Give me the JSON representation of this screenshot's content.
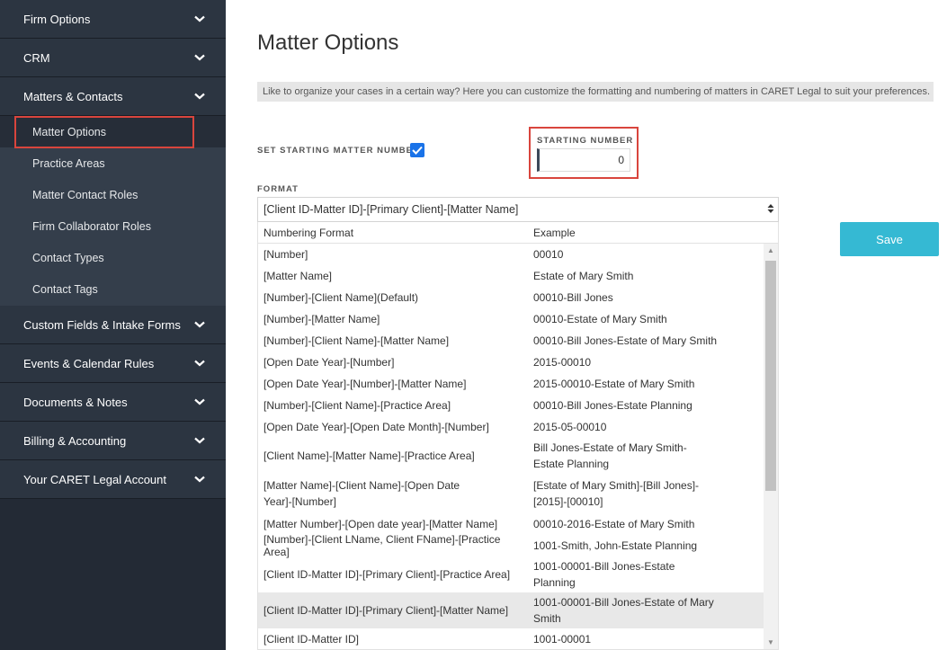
{
  "sidebar": {
    "sections_top": [
      {
        "label": "Firm Options"
      },
      {
        "label": "CRM"
      },
      {
        "label": "Matters & Contacts"
      }
    ],
    "sub_items": [
      {
        "label": "Matter Options"
      },
      {
        "label": "Practice Areas"
      },
      {
        "label": "Matter Contact Roles"
      },
      {
        "label": "Firm Collaborator Roles"
      },
      {
        "label": "Contact Types"
      },
      {
        "label": "Contact Tags"
      }
    ],
    "sections_bottom": [
      {
        "label": "Custom Fields & Intake Forms"
      },
      {
        "label": "Events & Calendar Rules"
      },
      {
        "label": "Documents & Notes"
      },
      {
        "label": "Billing & Accounting"
      },
      {
        "label": "Your CARET Legal Account"
      }
    ]
  },
  "main": {
    "title": "Matter Options",
    "info": "Like to organize your cases in a certain way? Here you can customize the formatting and numbering of matters in CARET Legal to suit your preferences.",
    "set_start_label": "SET STARTING MATTER NUMBER:",
    "set_start_checked": true,
    "starting_label": "STARTING NUMBER",
    "starting_value": "0",
    "format_label": "FORMAT",
    "format_selected": "[Client ID-Matter ID]-[Primary Client]-[Matter Name]",
    "save_label": "Save",
    "table": {
      "headers": [
        "Numbering Format",
        "Example"
      ],
      "rows": [
        {
          "format": "[Number]",
          "example": "00010"
        },
        {
          "format": "[Matter Name]",
          "example": "Estate of Mary Smith"
        },
        {
          "format": "[Number]-[Client Name](Default)",
          "example": "00010-Bill Jones"
        },
        {
          "format": "[Number]-[Matter Name]",
          "example": "00010-Estate of Mary Smith"
        },
        {
          "format": "[Number]-[Client Name]-[Matter Name]",
          "example": "00010-Bill Jones-Estate of Mary Smith"
        },
        {
          "format": "[Open Date Year]-[Number]",
          "example": "2015-00010"
        },
        {
          "format": "[Open Date Year]-[Number]-[Matter Name]",
          "example": "2015-00010-Estate of Mary Smith"
        },
        {
          "format": "[Number]-[Client Name]-[Practice Area]",
          "example": "00010-Bill Jones-Estate Planning"
        },
        {
          "format": "[Open Date Year]-[Open Date Month]-[Number]",
          "example": "2015-05-00010"
        },
        {
          "format": "[Client Name]-[Matter Name]-[Practice Area]",
          "example": "Bill Jones-Estate of Mary Smith-Estate Planning"
        },
        {
          "format": "[Matter Name]-[Client Name]-[Open Date Year]-[Number]",
          "example": "[Estate of Mary Smith]-[Bill Jones]-[2015]-[00010]"
        },
        {
          "format": "[Matter Number]-[Open date year]-[Matter Name]",
          "example": "00010-2016-Estate of Mary Smith"
        },
        {
          "format": "[Number]-[Client LName, Client FName]-[Practice Area]",
          "example": "1001-Smith, John-Estate Planning"
        },
        {
          "format": "[Client ID-Matter ID]-[Primary Client]-[Practice Area]",
          "example": "1001-00001-Bill Jones-Estate Planning"
        },
        {
          "format": "[Client ID-Matter ID]-[Primary Client]-[Matter Name]",
          "example": "1001-00001-Bill Jones-Estate of Mary Smith",
          "selected": true
        },
        {
          "format": "[Client ID-Matter ID]",
          "example": "1001-00001"
        }
      ]
    }
  },
  "colors": {
    "sidebar_bg": "#2c3541",
    "subnav_bg": "#343e4b",
    "highlight": "#d9453d",
    "accent": "#35b9d3",
    "checkbox": "#1a73e8"
  },
  "icons": {
    "section_toggle": "chevron-down-icon",
    "checkbox": "checkmark-icon",
    "select": "sort-arrows-icon"
  }
}
